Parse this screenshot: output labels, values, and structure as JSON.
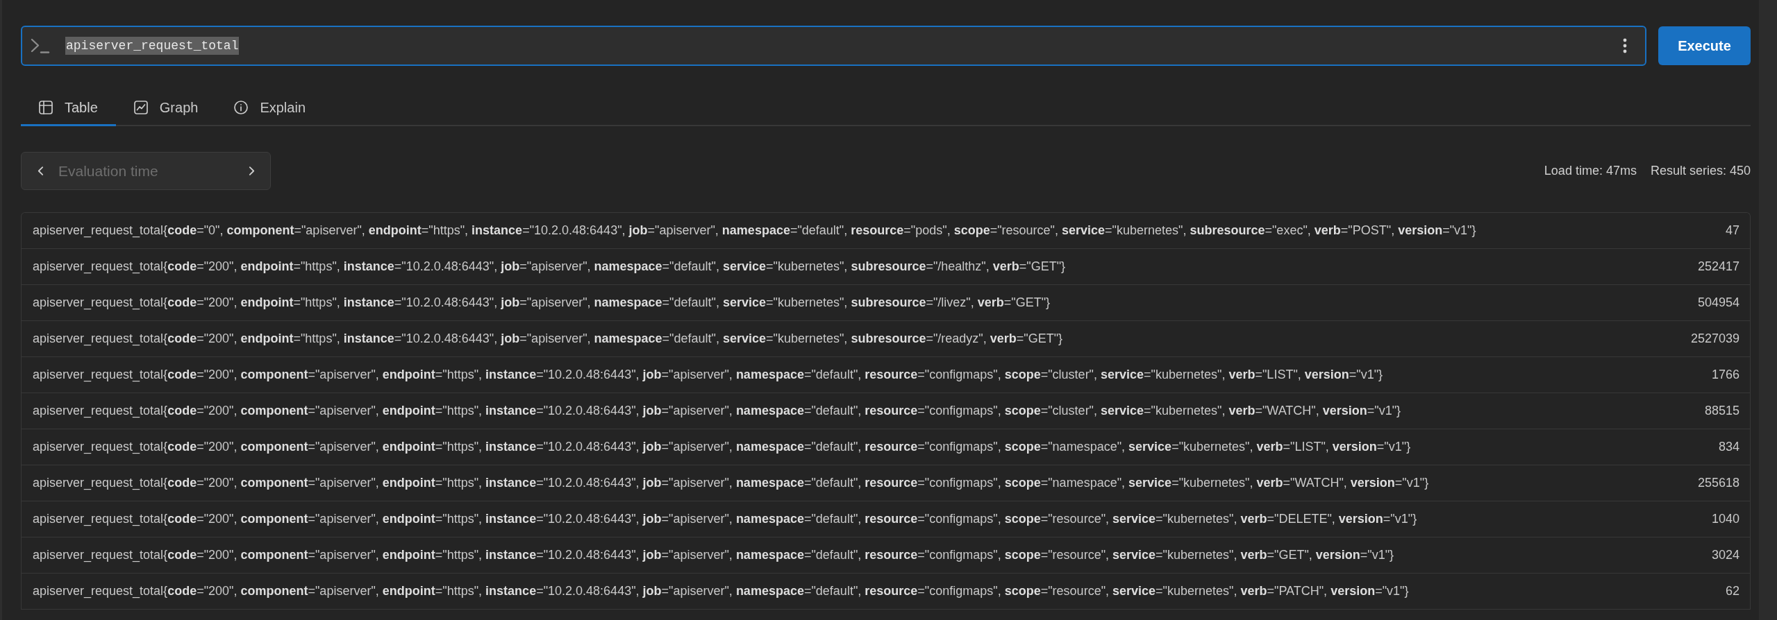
{
  "query": {
    "value": "apiserver_request_total",
    "text_selected": true
  },
  "execute_button": {
    "label": "Execute"
  },
  "tabs": [
    {
      "label": "Table",
      "selected": true
    },
    {
      "label": "Graph",
      "selected": false
    },
    {
      "label": "Explain",
      "selected": false
    }
  ],
  "evaluation_time": {
    "placeholder": "Evaluation time"
  },
  "stats": {
    "load_time": "Load time: 47ms",
    "result_series": "Result series: 450"
  },
  "table": {
    "rows": [
      {
        "series": "apiserver_request_total{**code**=\"0\", **component**=\"apiserver\", **endpoint**=\"https\", **instance**=\"10.2.0.48:6443\", **job**=\"apiserver\", **namespace**=\"default\", **resource**=\"pods\", **scope**=\"resource\", **service**=\"kubernetes\", **subresource**=\"exec\", **verb**=\"POST\", **version**=\"v1\"}",
        "value": "47"
      },
      {
        "series": "apiserver_request_total{**code**=\"200\", **endpoint**=\"https\", **instance**=\"10.2.0.48:6443\", **job**=\"apiserver\", **namespace**=\"default\", **service**=\"kubernetes\", **subresource**=\"/healthz\", **verb**=\"GET\"}",
        "value": "252417"
      },
      {
        "series": "apiserver_request_total{**code**=\"200\", **endpoint**=\"https\", **instance**=\"10.2.0.48:6443\", **job**=\"apiserver\", **namespace**=\"default\", **service**=\"kubernetes\", **subresource**=\"/livez\", **verb**=\"GET\"}",
        "value": "504954"
      },
      {
        "series": "apiserver_request_total{**code**=\"200\", **endpoint**=\"https\", **instance**=\"10.2.0.48:6443\", **job**=\"apiserver\", **namespace**=\"default\", **service**=\"kubernetes\", **subresource**=\"/readyz\", **verb**=\"GET\"}",
        "value": "2527039"
      },
      {
        "series": "apiserver_request_total{**code**=\"200\", **component**=\"apiserver\", **endpoint**=\"https\", **instance**=\"10.2.0.48:6443\", **job**=\"apiserver\", **namespace**=\"default\", **resource**=\"configmaps\", **scope**=\"cluster\", **service**=\"kubernetes\", **verb**=\"LIST\", **version**=\"v1\"}",
        "value": "1766"
      },
      {
        "series": "apiserver_request_total{**code**=\"200\", **component**=\"apiserver\", **endpoint**=\"https\", **instance**=\"10.2.0.48:6443\", **job**=\"apiserver\", **namespace**=\"default\", **resource**=\"configmaps\", **scope**=\"cluster\", **service**=\"kubernetes\", **verb**=\"WATCH\", **version**=\"v1\"}",
        "value": "88515"
      },
      {
        "series": "apiserver_request_total{**code**=\"200\", **component**=\"apiserver\", **endpoint**=\"https\", **instance**=\"10.2.0.48:6443\", **job**=\"apiserver\", **namespace**=\"default\", **resource**=\"configmaps\", **scope**=\"namespace\", **service**=\"kubernetes\", **verb**=\"LIST\", **version**=\"v1\"}",
        "value": "834"
      },
      {
        "series": "apiserver_request_total{**code**=\"200\", **component**=\"apiserver\", **endpoint**=\"https\", **instance**=\"10.2.0.48:6443\", **job**=\"apiserver\", **namespace**=\"default\", **resource**=\"configmaps\", **scope**=\"namespace\", **service**=\"kubernetes\", **verb**=\"WATCH\", **version**=\"v1\"}",
        "value": "255618"
      },
      {
        "series": "apiserver_request_total{**code**=\"200\", **component**=\"apiserver\", **endpoint**=\"https\", **instance**=\"10.2.0.48:6443\", **job**=\"apiserver\", **namespace**=\"default\", **resource**=\"configmaps\", **scope**=\"resource\", **service**=\"kubernetes\", **verb**=\"DELETE\", **version**=\"v1\"}",
        "value": "1040"
      },
      {
        "series": "apiserver_request_total{**code**=\"200\", **component**=\"apiserver\", **endpoint**=\"https\", **instance**=\"10.2.0.48:6443\", **job**=\"apiserver\", **namespace**=\"default\", **resource**=\"configmaps\", **scope**=\"resource\", **service**=\"kubernetes\", **verb**=\"GET\", **version**=\"v1\"}",
        "value": "3024"
      },
      {
        "series": "apiserver_request_total{**code**=\"200\", **component**=\"apiserver\", **endpoint**=\"https\", **instance**=\"10.2.0.48:6443\", **job**=\"apiserver\", **namespace**=\"default\", **resource**=\"configmaps\", **scope**=\"resource\", **service**=\"kubernetes\", **verb**=\"PATCH\", **version**=\"v1\"}",
        "value": "62"
      }
    ]
  }
}
